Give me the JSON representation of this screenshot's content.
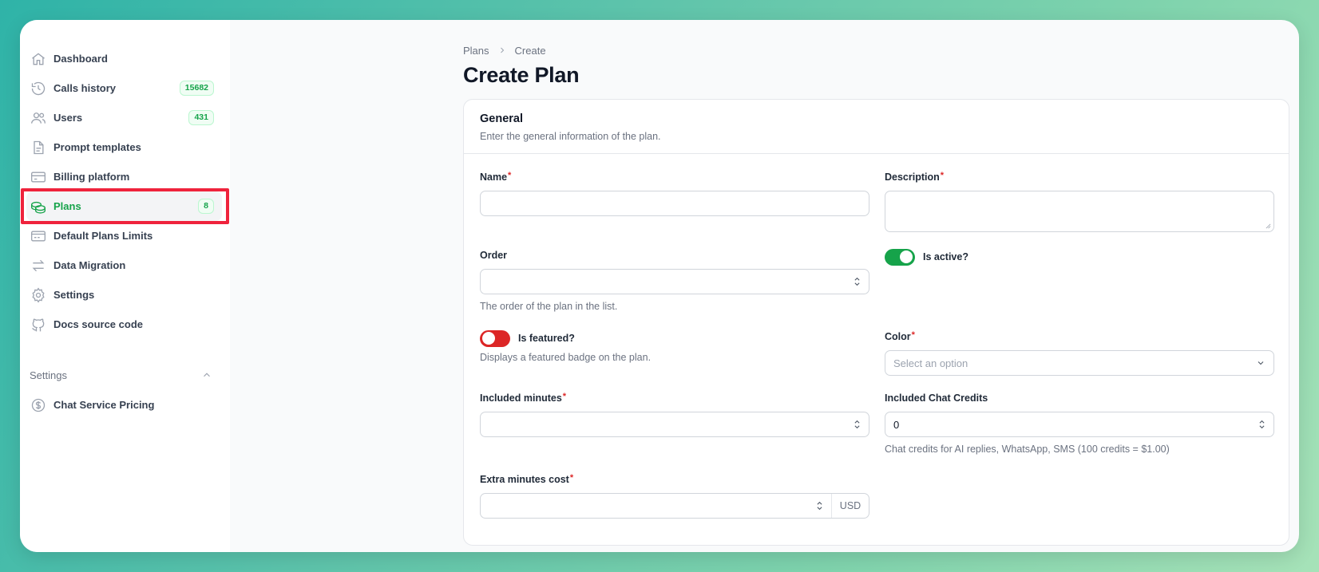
{
  "sidebar": {
    "items": [
      {
        "label": "Dashboard",
        "icon": "home-icon"
      },
      {
        "label": "Calls history",
        "icon": "history-icon",
        "badge": "15682"
      },
      {
        "label": "Users",
        "icon": "users-icon",
        "badge": "431"
      },
      {
        "label": "Prompt templates",
        "icon": "document-icon"
      },
      {
        "label": "Billing platform",
        "icon": "credit-card-icon"
      },
      {
        "label": "Plans",
        "icon": "plans-icon",
        "badge": "8",
        "active": true
      },
      {
        "label": "Default Plans Limits",
        "icon": "card-icon"
      },
      {
        "label": "Data Migration",
        "icon": "arrows-icon"
      },
      {
        "label": "Settings",
        "icon": "gear-icon"
      },
      {
        "label": "Docs source code",
        "icon": "github-icon"
      }
    ],
    "group": {
      "label": "Settings",
      "items": [
        {
          "label": "Chat Service Pricing",
          "icon": "dollar-icon"
        }
      ]
    }
  },
  "breadcrumb": {
    "items": [
      "Plans",
      "Create"
    ]
  },
  "page": {
    "title": "Create Plan"
  },
  "section": {
    "title": "General",
    "description": "Enter the general information of the plan."
  },
  "form": {
    "name": {
      "label": "Name",
      "value": ""
    },
    "description": {
      "label": "Description",
      "value": ""
    },
    "order": {
      "label": "Order",
      "value": "",
      "hint": "The order of the plan in the list."
    },
    "is_active": {
      "label": "Is active?",
      "state": "on"
    },
    "is_featured": {
      "label": "Is featured?",
      "state": "off",
      "hint": "Displays a featured badge on the plan."
    },
    "color": {
      "label": "Color",
      "placeholder": "Select an option"
    },
    "included_minutes": {
      "label": "Included minutes",
      "value": ""
    },
    "included_chat_credits": {
      "label": "Included Chat Credits",
      "value": "0",
      "hint": "Chat credits for AI replies, WhatsApp, SMS (100 credits = $1.00)"
    },
    "extra_minutes_cost": {
      "label": "Extra minutes cost",
      "value": "",
      "suffix": "USD"
    }
  },
  "colors": {
    "accent": "#16a34a",
    "danger": "#dc2626",
    "highlight": "#ef233c"
  }
}
